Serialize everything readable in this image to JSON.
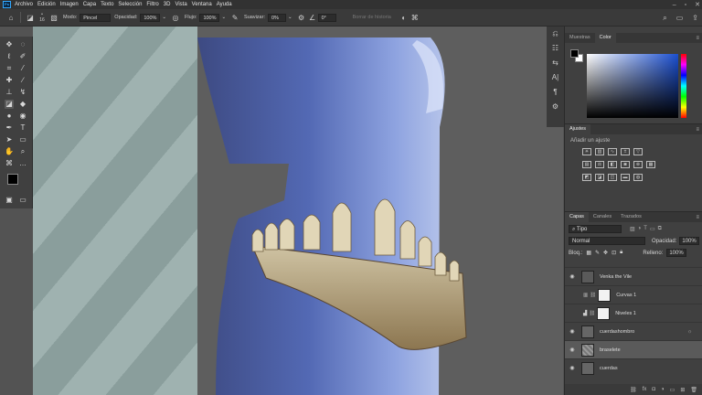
{
  "menubar": {
    "items": [
      "Archivo",
      "Edición",
      "Imagen",
      "Capa",
      "Texto",
      "Selección",
      "Filtro",
      "3D",
      "Vista",
      "Ventana",
      "Ayuda"
    ]
  },
  "options": {
    "size": "16",
    "mode_label": "Modo:",
    "mode_value": "Pincel",
    "opacity_label": "Opacidad:",
    "opacity_value": "100%",
    "flow_label": "Flujo:",
    "flow_value": "100%",
    "smooth_label": "Suavizar:",
    "smooth_value": "0%",
    "angle_value": "0°",
    "erase_history": "Borrar de historia"
  },
  "color_panel": {
    "tabs": [
      "Muestras",
      "Color"
    ]
  },
  "adjustments": {
    "tab": "Ajustes",
    "add_label": "Añadir un ajuste"
  },
  "layers": {
    "tabs": [
      "Capas",
      "Canales",
      "Trazados"
    ],
    "filter_value": "Tipo",
    "blend_mode": "Normal",
    "opacity_label": "Opacidad:",
    "opacity_value": "100%",
    "lock_label": "Bloq.:",
    "fill_label": "Relleno:",
    "fill_value": "100%",
    "items": [
      {
        "name": "Venka the Vile",
        "visible": true
      },
      {
        "name": "Curvas 1",
        "visible": false
      },
      {
        "name": "Niveles 1",
        "visible": false
      },
      {
        "name": "cuerdashombro",
        "visible": true
      },
      {
        "name": "braselete",
        "visible": true,
        "selected": true
      },
      {
        "name": "cuerdas",
        "visible": true
      }
    ]
  },
  "colors": {
    "accent": "#31a8ff",
    "panel_bg": "#404040",
    "skin_blue": "#6a82c6"
  }
}
